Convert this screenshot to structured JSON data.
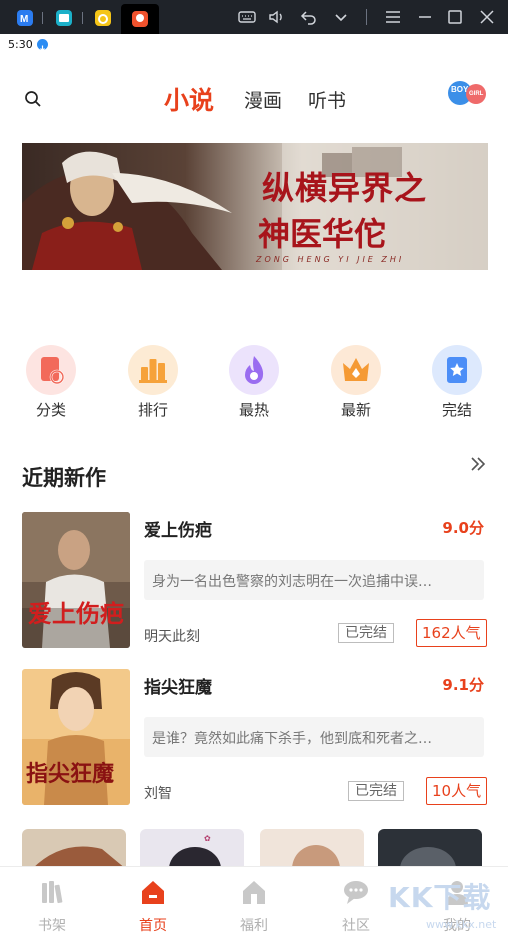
{
  "status": {
    "time": "5:30"
  },
  "header": {
    "tabs": [
      {
        "label": "小说",
        "active": true
      },
      {
        "label": "漫画",
        "active": false
      },
      {
        "label": "听书",
        "active": false
      }
    ],
    "gender_badge": {
      "boy": "BOY",
      "girl": "GIRL"
    }
  },
  "banner": {
    "title_line1": "纵横异界之",
    "title_line2": "神医华佗",
    "subtitle": "ZONG HENG YI JIE ZHI"
  },
  "categories": [
    {
      "label": "分类",
      "icon": "category-icon",
      "color": "#f26a5a"
    },
    {
      "label": "排行",
      "icon": "ranking-icon",
      "color": "#f6a23a"
    },
    {
      "label": "最热",
      "icon": "flame-icon",
      "color": "#9a6df0"
    },
    {
      "label": "最新",
      "icon": "new-icon",
      "color": "#f59a34"
    },
    {
      "label": "完结",
      "icon": "star-book-icon",
      "color": "#4c8ef7"
    }
  ],
  "section": {
    "title": "近期新作"
  },
  "books": [
    {
      "title": "爱上伤疤",
      "score": "9.0分",
      "desc": "身为一名出色警察的刘志明在一次追捕中误…",
      "author": "明天此刻",
      "status": "已完结",
      "popularity": "162人气",
      "cover_text": "爱上伤疤"
    },
    {
      "title": "指尖狂魔",
      "score": "9.1分",
      "desc": "是谁？竟然如此痛下杀手，他到底和死者之…",
      "author": "刘智",
      "status": "已完结",
      "popularity": "10人气",
      "cover_text": "指尖狂魔"
    }
  ],
  "bottom_nav": [
    {
      "label": "书架",
      "icon": "bookshelf-icon",
      "active": false
    },
    {
      "label": "首页",
      "icon": "home-icon",
      "active": true
    },
    {
      "label": "福利",
      "icon": "gift-house-icon",
      "active": false
    },
    {
      "label": "社区",
      "icon": "chat-icon",
      "active": false
    },
    {
      "label": "我的",
      "icon": "user-icon",
      "active": false
    }
  ],
  "watermark": {
    "text": "KK下载",
    "url": "www.kkx.net"
  },
  "colors": {
    "accent": "#e8411c",
    "topbar": "#1f2329"
  }
}
